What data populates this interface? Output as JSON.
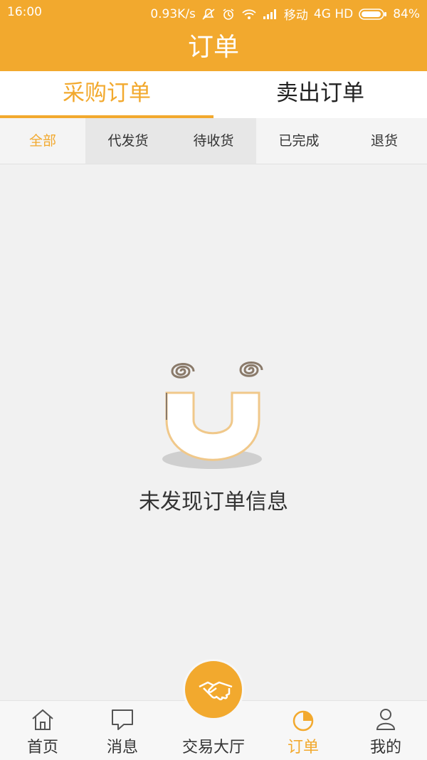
{
  "status": {
    "time": "16:00",
    "speed": "0.93K/s",
    "carrier": "移动",
    "network": "4G HD",
    "battery": "84%"
  },
  "header": {
    "title": "订单"
  },
  "tabs": [
    {
      "label": "采购订单",
      "active": true
    },
    {
      "label": "卖出订单",
      "active": false
    }
  ],
  "subtabs": [
    {
      "label": "全部",
      "active": true
    },
    {
      "label": "代发货"
    },
    {
      "label": "待收货"
    },
    {
      "label": "已完成"
    },
    {
      "label": "退货"
    }
  ],
  "empty": {
    "message": "未发现订单信息"
  },
  "bottom_nav": [
    {
      "label": "首页",
      "icon": "home-icon"
    },
    {
      "label": "消息",
      "icon": "message-icon"
    },
    {
      "label": "交易大厅",
      "icon": "handshake-icon"
    },
    {
      "label": "订单",
      "icon": "pie-chart-icon",
      "active": true
    },
    {
      "label": "我的",
      "icon": "user-icon"
    }
  ],
  "colors": {
    "accent": "#f2a92e",
    "background": "#f1f1f1"
  }
}
